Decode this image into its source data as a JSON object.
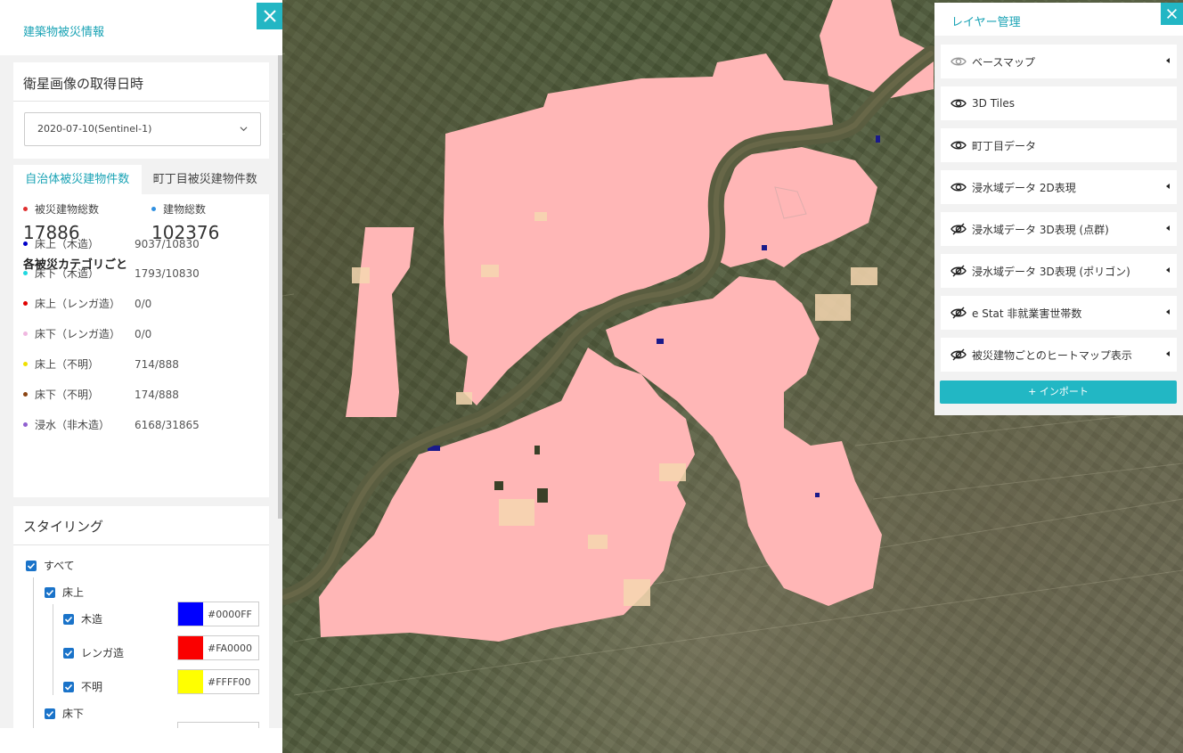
{
  "left_panel": {
    "title": "建築物被災情報",
    "date_card": {
      "title": "衛星画像の取得日時",
      "selected_date": "2020-07-10(Sentinel-1)"
    },
    "stats": {
      "tabs": [
        "自治体被災建物件数",
        "町丁目被災建物件数"
      ],
      "active_tab": 0,
      "damaged_total_label": "被災建物総数",
      "damaged_total": "17886",
      "building_total_label": "建物総数",
      "building_total": "102376",
      "category_heading": "各被災カテゴリごと",
      "categories": [
        {
          "name": "床上（木造）",
          "value": "9037/10830",
          "color": "#0000C8"
        },
        {
          "name": "床下（木造）",
          "value": "1793/10830",
          "color": "#20D8E0"
        },
        {
          "name": "床上（レンガ造）",
          "value": "0/0",
          "color": "#E00000"
        },
        {
          "name": "床下（レンガ造）",
          "value": "0/0",
          "color": "#F0B8E0"
        },
        {
          "name": "床上（不明）",
          "value": "714/888",
          "color": "#F0E000"
        },
        {
          "name": "床下（不明）",
          "value": "174/888",
          "color": "#8B4513"
        },
        {
          "name": "浸水（非木造）",
          "value": "6168/31865",
          "color": "#9060D0"
        }
      ],
      "damaged_dot_color": "#E03030",
      "building_dot_color": "#3090E0"
    },
    "styling": {
      "title": "スタイリング",
      "all_label": "すべて",
      "floor_above_label": "床上",
      "items": [
        {
          "label": "木造",
          "hex": "#0000FF"
        },
        {
          "label": "レンガ造",
          "hex": "#FA0000"
        },
        {
          "label": "不明",
          "hex": "#FFFF00"
        }
      ],
      "floor_below_label": "床下"
    }
  },
  "right_panel": {
    "title": "レイヤー管理",
    "layers": [
      {
        "label": "ベースマップ",
        "visible": true,
        "muted": true,
        "expandable": true
      },
      {
        "label": "3D Tiles",
        "visible": true,
        "muted": false,
        "expandable": false
      },
      {
        "label": "町丁目データ",
        "visible": true,
        "muted": false,
        "expandable": false
      },
      {
        "label": "浸水域データ 2D表現",
        "visible": true,
        "muted": false,
        "expandable": true
      },
      {
        "label": "浸水域データ 3D表現 (点群)",
        "visible": false,
        "muted": false,
        "expandable": true
      },
      {
        "label": "浸水域データ 3D表現 (ポリゴン)",
        "visible": false,
        "muted": false,
        "expandable": true
      },
      {
        "label": "e Stat 非就業害世帯数",
        "visible": false,
        "muted": false,
        "expandable": true
      },
      {
        "label": "被災建物ごとのヒートマップ表示",
        "visible": false,
        "muted": false,
        "expandable": true
      }
    ],
    "import_label": "+ インポート"
  },
  "colors": {
    "accent": "#23B6C4",
    "flood": "#FFB6B6",
    "river": "#5A5A40"
  }
}
